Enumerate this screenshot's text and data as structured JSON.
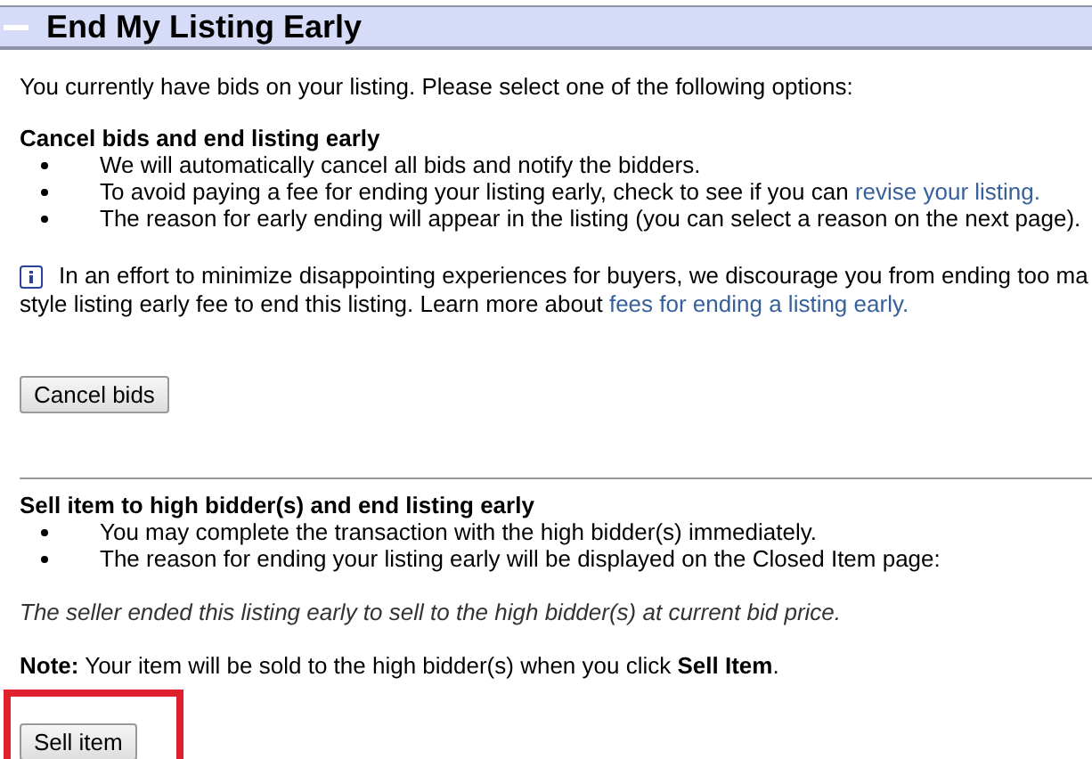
{
  "header": {
    "title": "End My Listing Early"
  },
  "intro": "You currently have bids on your listing. Please select one of the following options:",
  "cancel_section": {
    "heading": "Cancel bids and end listing early",
    "bullets": [
      {
        "text": "We will automatically cancel all bids and notify the bidders."
      },
      {
        "text": "To avoid paying a fee for ending your listing early, check to see if you can ",
        "link": "revise your listing."
      },
      {
        "text": "The reason for early ending will appear in the listing (you can select a reason on the next page)."
      }
    ],
    "info": {
      "line_1": "In an effort to minimize disappointing experiences for buyers, we discourage you from ending too ma",
      "line_2": "style listing early fee to end this listing. Learn more about ",
      "link": "fees for ending a listing early."
    },
    "button": {
      "label": "Cancel bids",
      "highlighted": false
    }
  },
  "sell_section": {
    "heading": "Sell item to high bidder(s) and end listing early",
    "bullets": [
      {
        "text": "You may complete the transaction with the high bidder(s) immediately."
      },
      {
        "text": "The reason for ending your listing early will be displayed on the Closed Item page:"
      }
    ],
    "quote": "The seller ended this listing early to sell to the high bidder(s) at current bid price.",
    "note": "**Note:** Your item will be sold to the high bidder(s) when you click **Sell Item**.",
    "button": {
      "label": "Sell item",
      "highlighted": true
    }
  }
}
